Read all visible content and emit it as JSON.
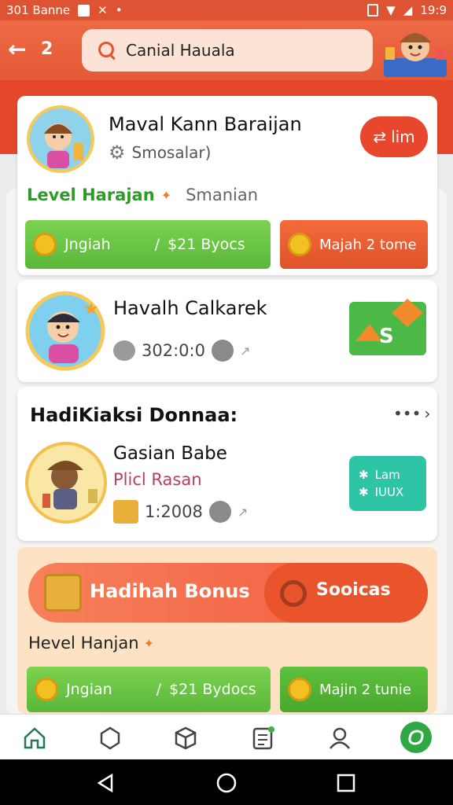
{
  "status_bar": {
    "left_text": "301 Banne",
    "time": "19:9"
  },
  "header": {
    "back_label": "←",
    "secondary_label": "2",
    "search_value": "Canial Hauala"
  },
  "profile": {
    "name": "Maval Kann Baraijan",
    "subtitle": "Smosalar)",
    "level_label": "Level Harajan",
    "level_value": "Smanian",
    "badge_text": "lim",
    "btn_left": {
      "label": "Jngiah",
      "sep": "/",
      "value": "$21 Byocs"
    },
    "btn_right": {
      "label": "Majah 2 tome"
    }
  },
  "friend": {
    "name": "Havalh Calkarek",
    "amount": "302:0:0"
  },
  "section": {
    "title": "HadiKiaksi Donnaa:",
    "more": "•••"
  },
  "gift": {
    "name": "Gasian Babe",
    "sub": "Plicl Rasan",
    "amount": "1:2008",
    "action_line1": "Lam",
    "action_line2": "IUUX"
  },
  "bonus": {
    "banner_label": "Hadihah Bonus",
    "banner_right": "Sooicas",
    "level_label": "Hevel Hanjan",
    "btn_left": {
      "label": "Jngian",
      "sep": "/",
      "value": "$21 Bydocs"
    },
    "btn_right": {
      "label": "Majin 2 tunie"
    }
  },
  "colors": {
    "accent": "#e5472b",
    "green": "#5bb73a",
    "teal": "#2ec4a6",
    "orange": "#e0522a"
  }
}
